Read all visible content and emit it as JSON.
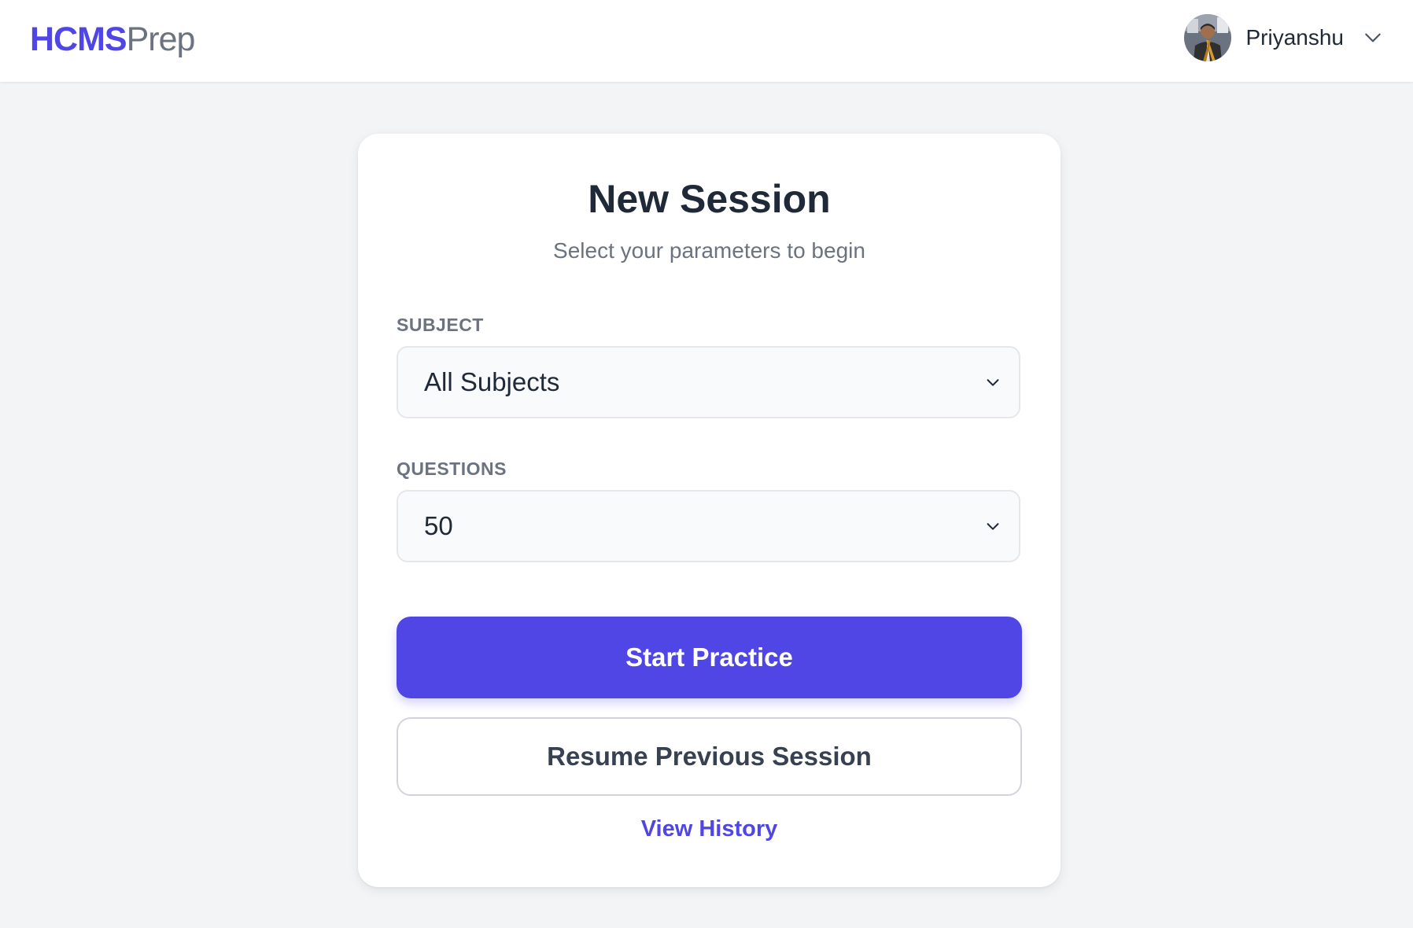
{
  "header": {
    "brand_bold": "HCMS",
    "brand_light": "Prep",
    "user": {
      "name": "Priyanshu",
      "avatar_icon": "user-avatar",
      "menu_icon": "chevron-down-icon"
    }
  },
  "session_form": {
    "title": "New Session",
    "subtitle": "Select your parameters to begin",
    "subject": {
      "label": "SUBJECT",
      "selected": "All Subjects"
    },
    "questions": {
      "label": "QUESTIONS",
      "selected": "50"
    },
    "start_button": "Start Practice",
    "resume_button": "Resume Previous Session",
    "history_link": "View History"
  },
  "colors": {
    "accent": "#4f46e5",
    "page_background": "#f3f4f6",
    "card_background": "#ffffff",
    "text_primary": "#1f2937",
    "text_muted": "#6b7280"
  }
}
